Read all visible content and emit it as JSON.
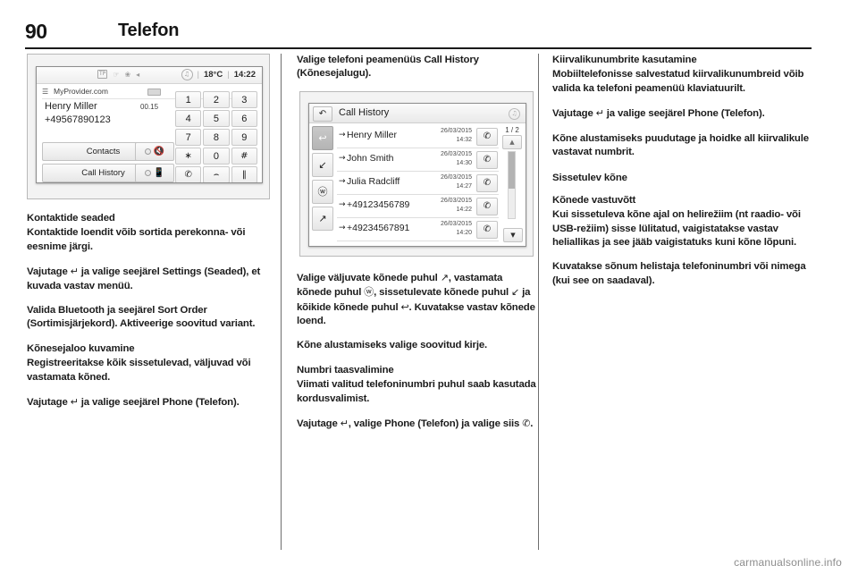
{
  "page": {
    "number": "90",
    "chapter": "Telefon",
    "watermark": "carmanualsonline.info"
  },
  "figure_phone_screen": {
    "status_bar": {
      "tp_label": "TP",
      "icons": [
        "phone-mute-icon",
        "bluetooth-icon",
        "volume-mute-icon"
      ],
      "media_icon": "music-note-icon",
      "separator": "|",
      "temperature": "18°C",
      "time": "14:22"
    },
    "provider": {
      "signal_icon": "signal-bars-icon",
      "name": "MyProvider.com",
      "battery_icon": "battery-icon"
    },
    "call": {
      "caller_name": "Henry Miller",
      "duration": "00.15",
      "number": "+49567890123"
    },
    "soft_buttons": [
      {
        "label": "Contacts"
      },
      {
        "label": "Call History"
      }
    ],
    "icon_buttons": [
      {
        "icon": "microphone-mute-icon"
      },
      {
        "icon": "handset-speaker-icon"
      }
    ],
    "keypad": [
      {
        "label": "1",
        "glyph": false
      },
      {
        "label": "2",
        "glyph": false
      },
      {
        "label": "3",
        "glyph": false
      },
      {
        "label": "4",
        "glyph": false
      },
      {
        "label": "5",
        "glyph": false
      },
      {
        "label": "6",
        "glyph": false
      },
      {
        "label": "7",
        "glyph": false
      },
      {
        "label": "8",
        "glyph": false
      },
      {
        "label": "9",
        "glyph": false
      },
      {
        "label": "∗",
        "glyph": true
      },
      {
        "label": "0",
        "glyph": false
      },
      {
        "label": "#",
        "glyph": true
      },
      {
        "label": "✆",
        "glyph": true
      },
      {
        "label": "⌢",
        "glyph": true
      },
      {
        "label": "‖",
        "glyph": true
      }
    ]
  },
  "figure_call_history": {
    "title": "Call History",
    "back_icon": "back-arrow-icon",
    "media_icon": "music-note-icon",
    "filter_tabs": [
      {
        "icon": "↩",
        "name": "missed-calls-tab",
        "active": true
      },
      {
        "icon": "↙",
        "name": "incoming-calls-tab",
        "active": false
      },
      {
        "icon": "ⓦ",
        "name": "rejected-calls-tab",
        "active": false
      },
      {
        "icon": "↗",
        "name": "outgoing-calls-tab",
        "active": false
      }
    ],
    "rows": [
      {
        "direction": "→",
        "name": "Henry Miller",
        "date": "26/03/2015",
        "time": "14:32",
        "call_icon": "✆"
      },
      {
        "direction": "→",
        "name": "John Smith",
        "date": "26/03/2015",
        "time": "14:30",
        "call_icon": "✆"
      },
      {
        "direction": "→",
        "name": "Julia Radcliff",
        "date": "26/03/2015",
        "time": "14:27",
        "call_icon": "✆"
      },
      {
        "direction": "→",
        "name": "+49123456789",
        "date": "26/03/2015",
        "time": "14:22",
        "call_icon": "✆"
      },
      {
        "direction": "→",
        "name": "+49234567891",
        "date": "26/03/2015",
        "time": "14:20",
        "call_icon": "✆"
      }
    ],
    "page_indicator": "1 / 2",
    "scroll_up_icon": "▲",
    "scroll_down_icon": "▼"
  },
  "column_1": {
    "heading_1": "Kontaktide seaded",
    "para_1": "Kontaktide loendit võib sortida perekonna- või eesnime järgi.",
    "para_2_pre": "Vajutage ",
    "para_2_sym": "↵",
    "para_2_post": " ja valige seejärel Settings (Seaded), et kuvada vastav menüü.",
    "para_3": "Valida Bluetooth ja seejärel Sort Order (Sortimisjärjekord). Aktiveerige soovitud variant.",
    "heading_2": "Kõnesejaloo kuvamine",
    "para_4": "Registreeritakse kõik sissetulevad, väljuvad või vastamata kõned.",
    "para_5_pre": "Vajutage ",
    "para_5_sym": "↵",
    "para_5_post": " ja valige seejärel Phone (Telefon)."
  },
  "column_2": {
    "para_1": "Valige telefoni peamenüüs Call History (Kõnesejalugu).",
    "para_2_a": "Valige väljuvate kõnede puhul ",
    "para_2_sym1": "↗",
    "para_2_b": ", vastamata kõnede puhul ",
    "para_2_sym2": "ⓦ",
    "para_2_c": ", sissetulevate kõnede puhul ",
    "para_2_sym3": "↙",
    "para_2_d": " ja kõikide kõnede puhul ",
    "para_2_sym4": "↩",
    "para_2_e": ". Kuvatakse vastav kõnede loend.",
    "para_3": "Kõne alustamiseks valige soovitud kirje.",
    "heading_1": "Numbri taasvalimine",
    "para_4": "Viimati valitud telefoninumbri puhul saab kasutada kordusvalimist.",
    "para_5_pre": "Vajutage ",
    "para_5_sym": "↵",
    "para_5_mid": ", valige Phone (Telefon) ja valige siis ",
    "para_5_sym2": "✆",
    "para_5_post": "."
  },
  "column_3": {
    "heading_1": "Kiirvalikunumbrite kasutamine",
    "para_1": "Mobiiltelefonisse salvestatud kiirvalikunumbreid võib valida ka telefoni peamenüü klaviatuurilt.",
    "para_2_pre": "Vajutage ",
    "para_2_sym": "↵",
    "para_2_post": " ja valige seejärel Phone (Telefon).",
    "para_3": "Kõne alustamiseks puudutage ja hoidke all kiirvalikule vastavat numbrit.",
    "heading_2": "Sissetulev kõne",
    "heading_3": "Kõnede vastuvõtt",
    "para_4": "Kui sissetuleva kõne ajal on helirežiim (nt raadio- või USB-režiim) sisse lülitatud, vaigistatakse vastav heliallikas ja see jääb vaigistatuks kuni kõne lõpuni.",
    "para_5": "Kuvatakse sõnum helistaja telefoninumbri või nimega (kui see on saadaval)."
  }
}
